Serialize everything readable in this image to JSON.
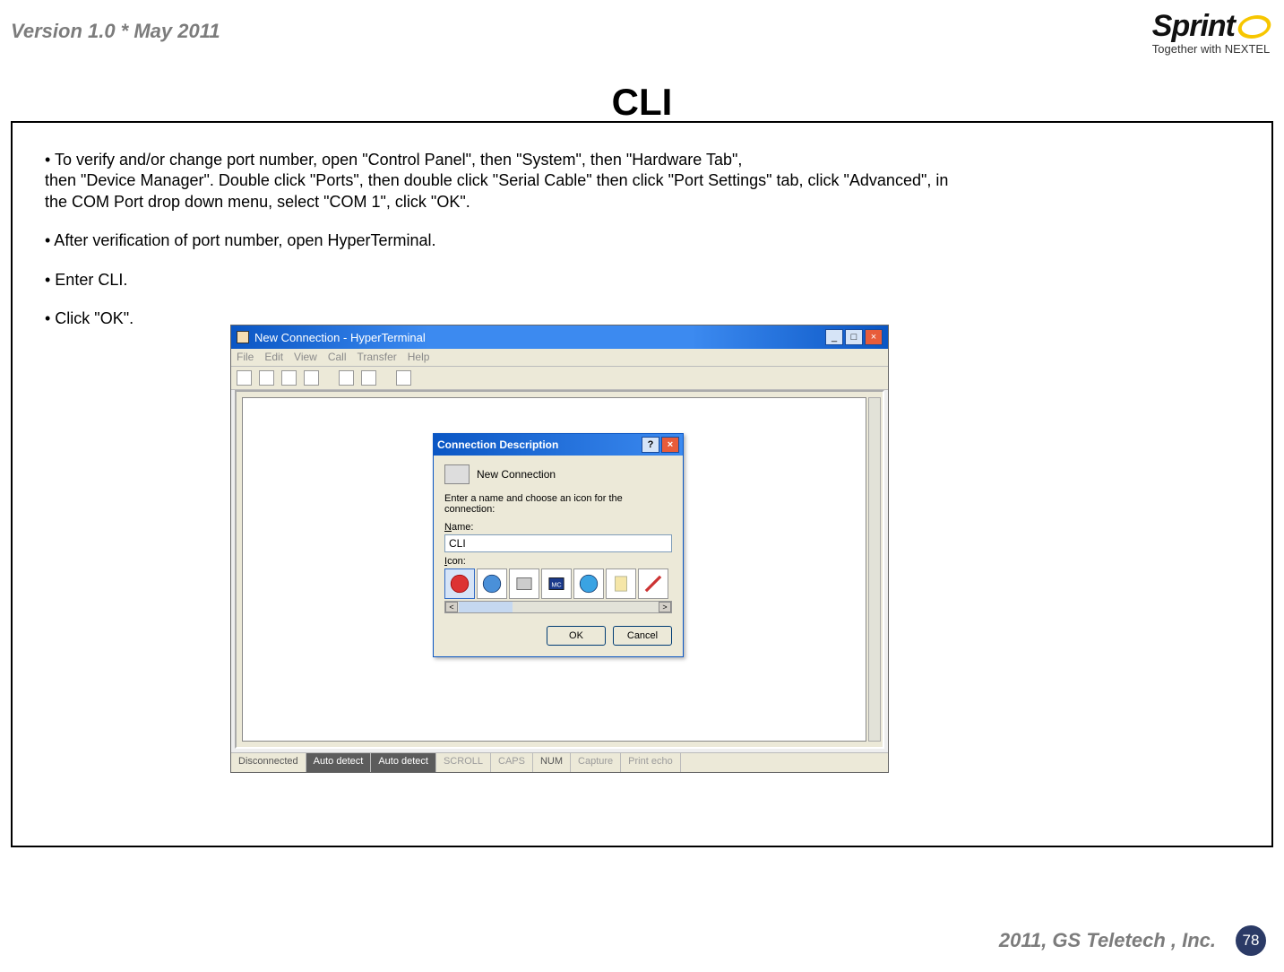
{
  "header": {
    "version": "Version 1.0 * May 2011",
    "logo_main": "Sprint",
    "logo_sub": "Together with NEXTEL"
  },
  "title": "CLI",
  "bullet1": "• To verify and/or change port number, open \"Control Panel\", then \"System\", then \"Hardware Tab\",",
  "bullet1b": "then \"Device Manager\". Double click \"Ports\", then double click \"Serial Cable\" then click \"Port Settings\"  tab, click \"Advanced\", in",
  "bullet1c": "the COM Port drop down menu, select \"COM 1\", click \"OK\".",
  "bullet2": "• After verification of port number, open HyperTerminal.",
  "bullet3": "• Enter CLI.",
  "bullet4": "• Click \"OK\".",
  "window": {
    "title": "New Connection - HyperTerminal",
    "menus": [
      "File",
      "Edit",
      "View",
      "Call",
      "Transfer",
      "Help"
    ],
    "status": {
      "conn": "Disconnected",
      "det1": "Auto detect",
      "det2": "Auto detect",
      "scroll": "SCROLL",
      "caps": "CAPS",
      "num": "NUM",
      "capture": "Capture",
      "echo": "Print echo"
    }
  },
  "dialog": {
    "title": "Connection Description",
    "heading": "New Connection",
    "prompt": "Enter a name and choose an icon for the connection:",
    "name_label": "Name:",
    "name_value": "CLI",
    "icon_label": "Icon:",
    "ok": "OK",
    "cancel": "Cancel"
  },
  "footer": {
    "copyright": "2011, GS Teletech , Inc.",
    "page": "78"
  }
}
